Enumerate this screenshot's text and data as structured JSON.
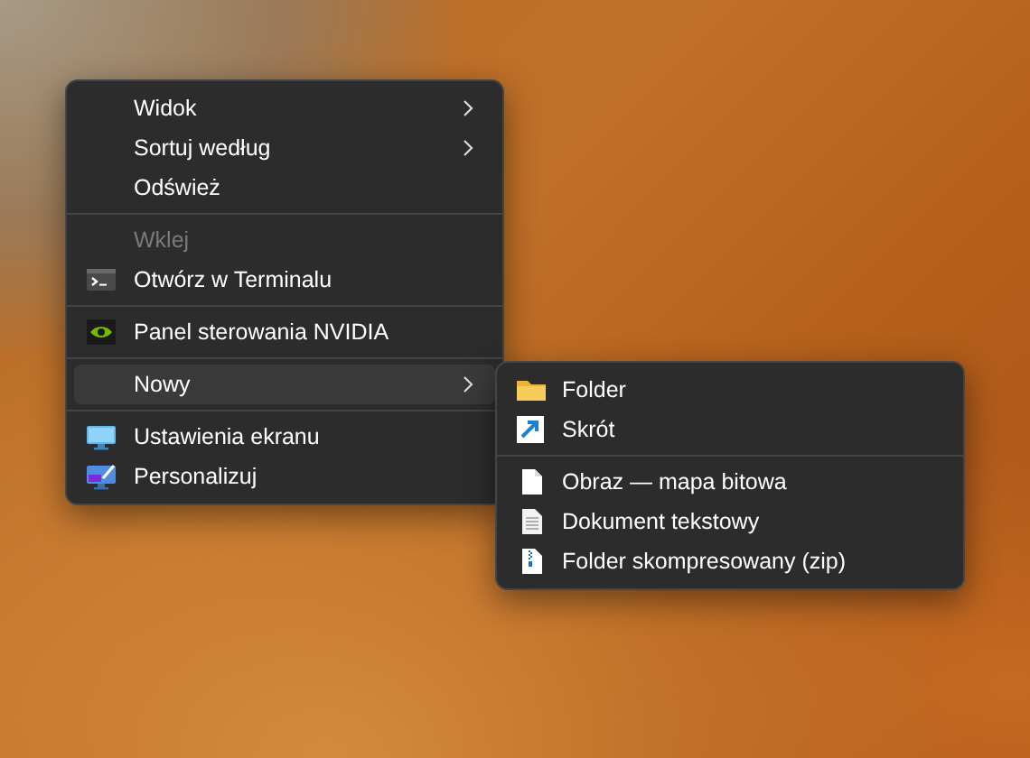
{
  "context_menu": {
    "items": [
      {
        "kind": "plain",
        "label": "Widok",
        "has_submenu": true,
        "disabled": false,
        "selected": false
      },
      {
        "kind": "plain",
        "label": "Sortuj według",
        "has_submenu": true,
        "disabled": false,
        "selected": false
      },
      {
        "kind": "plain",
        "label": "Odśwież",
        "has_submenu": false,
        "disabled": false,
        "selected": false
      },
      {
        "kind": "separator"
      },
      {
        "kind": "plain",
        "label": "Wklej",
        "has_submenu": false,
        "disabled": true,
        "selected": false
      },
      {
        "kind": "terminal",
        "label": "Otwórz w Terminalu",
        "has_submenu": false,
        "disabled": false,
        "selected": false
      },
      {
        "kind": "separator"
      },
      {
        "kind": "gpu",
        "label": "Panel sterowania NVIDIA",
        "has_submenu": false,
        "disabled": false,
        "selected": false
      },
      {
        "kind": "separator"
      },
      {
        "kind": "plain",
        "label": "Nowy",
        "has_submenu": true,
        "disabled": false,
        "selected": true
      },
      {
        "kind": "separator"
      },
      {
        "kind": "display",
        "label": "Ustawienia ekranu",
        "has_submenu": false,
        "disabled": false,
        "selected": false
      },
      {
        "kind": "personalize",
        "label": "Personalizuj",
        "has_submenu": false,
        "disabled": false,
        "selected": false
      }
    ]
  },
  "submenu": {
    "items": [
      {
        "kind": "folder",
        "label": "Folder"
      },
      {
        "kind": "shortcut",
        "label": "Skrót"
      },
      {
        "kind": "separator"
      },
      {
        "kind": "image",
        "label": "Obraz — mapa bitowa"
      },
      {
        "kind": "text",
        "label": "Dokument tekstowy"
      },
      {
        "kind": "archive",
        "label": "Folder skompresowany (zip)"
      }
    ]
  }
}
